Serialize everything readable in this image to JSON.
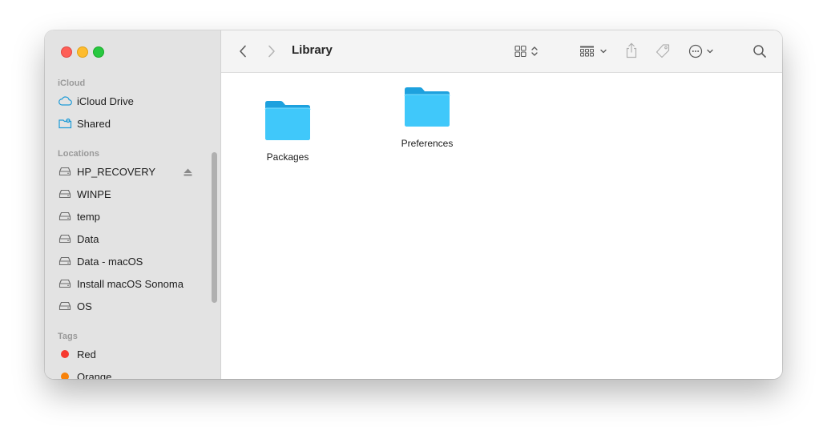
{
  "window": {
    "title": "Library"
  },
  "sidebar": {
    "sections": [
      {
        "label": "iCloud"
      },
      {
        "label": "Locations"
      },
      {
        "label": "Tags"
      }
    ],
    "icloud_items": [
      {
        "label": "iCloud Drive",
        "icon": "cloud-icon"
      },
      {
        "label": "Shared",
        "icon": "shared-folder-icon"
      }
    ],
    "location_items": [
      {
        "label": "HP_RECOVERY",
        "icon": "drive-icon",
        "ejectable": true
      },
      {
        "label": "WINPE",
        "icon": "drive-icon"
      },
      {
        "label": "temp",
        "icon": "drive-icon"
      },
      {
        "label": "Data",
        "icon": "drive-icon"
      },
      {
        "label": "Data - macOS",
        "icon": "drive-icon"
      },
      {
        "label": "Install macOS Sonoma",
        "icon": "drive-icon"
      },
      {
        "label": "OS",
        "icon": "drive-icon"
      }
    ],
    "tag_items": [
      {
        "label": "Red",
        "color": "#f6382e"
      },
      {
        "label": "Orange",
        "color": "#f7820a"
      }
    ]
  },
  "toolbar": {
    "icons": [
      "chevron-left-icon",
      "chevron-right-icon",
      "grid-view-icon",
      "group-by-icon",
      "share-icon",
      "tag-icon",
      "more-actions-icon",
      "search-icon"
    ]
  },
  "content": {
    "items": [
      {
        "name": "Packages",
        "icon": "folder-icon"
      },
      {
        "name": "Preferences",
        "icon": "folder-icon"
      }
    ]
  },
  "colors": {
    "accent": "#1e9bd7",
    "folder_front": "#40c8fa",
    "folder_back": "#1da1de"
  }
}
